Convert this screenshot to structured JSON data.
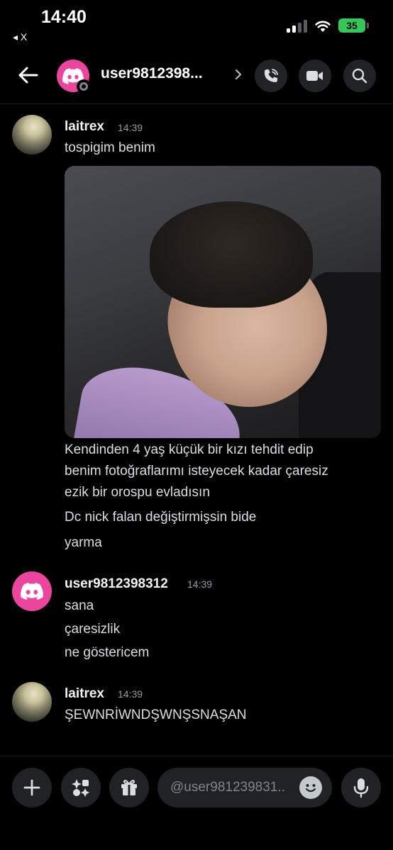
{
  "status_bar": {
    "time": "14:40",
    "back_app": "◂ X",
    "battery": "35"
  },
  "header": {
    "name": "user9812398..."
  },
  "messages": [
    {
      "author": "laitrex",
      "timestamp": "14:39",
      "lines": [
        "tospigim benim"
      ],
      "after_image_lines": [
        "Kendinden 4 yaş küçük bir kızı tehdit edip",
        "benim fotoğraflarımı isteyecek kadar çaresiz",
        "ezik bir orospu evladısın",
        "Dc nick falan değiştirmişsin bide",
        "yarma"
      ]
    },
    {
      "author": "user9812398312",
      "timestamp": "14:39",
      "lines": [
        "sana",
        "çaresizlik",
        "ne göstericem"
      ]
    },
    {
      "author": "laitrex",
      "timestamp": "14:39",
      "lines": [
        "ŞEWNRİWNDŞWNŞSNAŞAN"
      ]
    }
  ],
  "composer": {
    "placeholder": "@user981239831.."
  },
  "colors": {
    "background": "#000000",
    "discord_pink": "#eb459e",
    "button_bg": "#202226",
    "muted": "#949ba4"
  }
}
